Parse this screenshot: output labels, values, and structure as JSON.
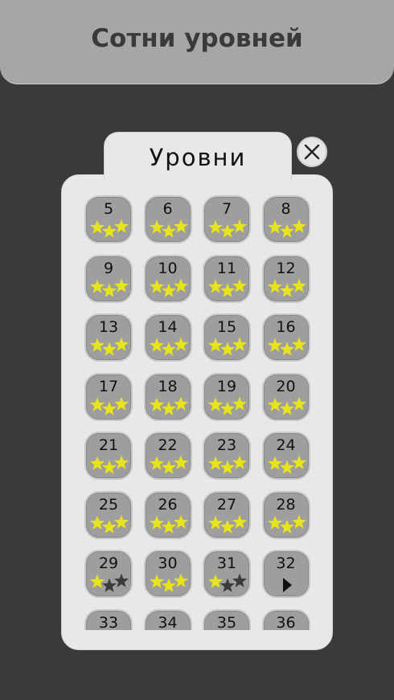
{
  "banner": {
    "title": "Сотни уровней"
  },
  "panel": {
    "title": "Уровни"
  },
  "colors": {
    "star_earned": "#e7e31c",
    "star_empty": "#3c3c3c",
    "tile": "#9e9e9e",
    "panel": "#e8e8e8"
  },
  "icons": {
    "close": "close-icon",
    "play": "play-icon",
    "star": "star-icon"
  },
  "levels": [
    {
      "number": "5",
      "stars": 3
    },
    {
      "number": "6",
      "stars": 3
    },
    {
      "number": "7",
      "stars": 3
    },
    {
      "number": "8",
      "stars": 3
    },
    {
      "number": "9",
      "stars": 3
    },
    {
      "number": "10",
      "stars": 3
    },
    {
      "number": "11",
      "stars": 3
    },
    {
      "number": "12",
      "stars": 3
    },
    {
      "number": "13",
      "stars": 3
    },
    {
      "number": "14",
      "stars": 3
    },
    {
      "number": "15",
      "stars": 3
    },
    {
      "number": "16",
      "stars": 3
    },
    {
      "number": "17",
      "stars": 3
    },
    {
      "number": "18",
      "stars": 3
    },
    {
      "number": "19",
      "stars": 3
    },
    {
      "number": "20",
      "stars": 3
    },
    {
      "number": "21",
      "stars": 3
    },
    {
      "number": "22",
      "stars": 3
    },
    {
      "number": "23",
      "stars": 3
    },
    {
      "number": "24",
      "stars": 3
    },
    {
      "number": "25",
      "stars": 3
    },
    {
      "number": "26",
      "stars": 3
    },
    {
      "number": "27",
      "stars": 3
    },
    {
      "number": "28",
      "stars": 3
    },
    {
      "number": "29",
      "stars": 1
    },
    {
      "number": "30",
      "stars": 3
    },
    {
      "number": "31",
      "stars": 1
    },
    {
      "number": "32",
      "stars": 0,
      "current": true
    },
    {
      "number": "33",
      "stars": 0
    },
    {
      "number": "34",
      "stars": 0
    },
    {
      "number": "35",
      "stars": 0
    },
    {
      "number": "36",
      "stars": 0
    }
  ]
}
